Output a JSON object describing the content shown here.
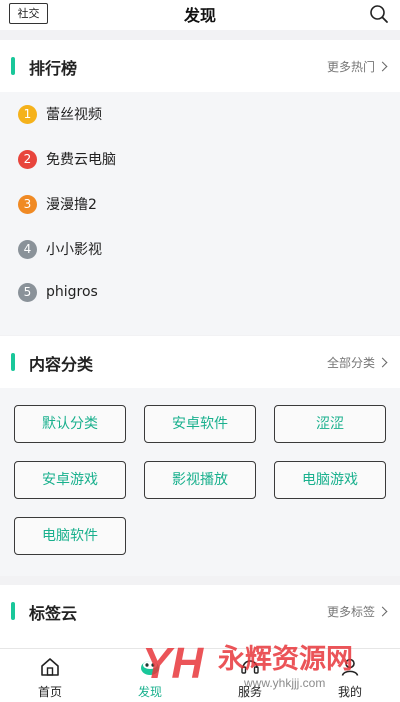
{
  "header": {
    "social_label": "社交",
    "title": "发现",
    "search_icon": "search-icon"
  },
  "ranking": {
    "title": "排行榜",
    "more_label": "更多热门",
    "items": [
      {
        "rank": "1",
        "label": "蕾丝视频",
        "color": "#f5b21b"
      },
      {
        "rank": "2",
        "label": "免费云电脑",
        "color": "#e8453c"
      },
      {
        "rank": "3",
        "label": "漫漫撸2",
        "color": "#f08a24"
      },
      {
        "rank": "4",
        "label": "小小影视",
        "color": "#8a9299"
      },
      {
        "rank": "5",
        "label": "phigros",
        "color": "#8a9299"
      }
    ]
  },
  "categories": {
    "title": "内容分类",
    "more_label": "全部分类",
    "items": [
      "默认分类",
      "安卓软件",
      "涩涩",
      "安卓游戏",
      "影视播放",
      "电脑游戏",
      "电脑软件"
    ]
  },
  "tags": {
    "title": "标签云",
    "more_label": "更多标签"
  },
  "tabbar": {
    "tabs": [
      {
        "label": "首页",
        "icon": "home-icon"
      },
      {
        "label": "发现",
        "icon": "discover-icon"
      },
      {
        "label": "服务",
        "icon": "service-icon"
      },
      {
        "label": "我的",
        "icon": "profile-icon"
      }
    ]
  },
  "watermark": {
    "logo_text": "YH",
    "brand": "永辉资源网",
    "url": "www.yhkjjj.com"
  },
  "colors": {
    "accent": "#19c79a",
    "accent_text": "#19b08d"
  }
}
